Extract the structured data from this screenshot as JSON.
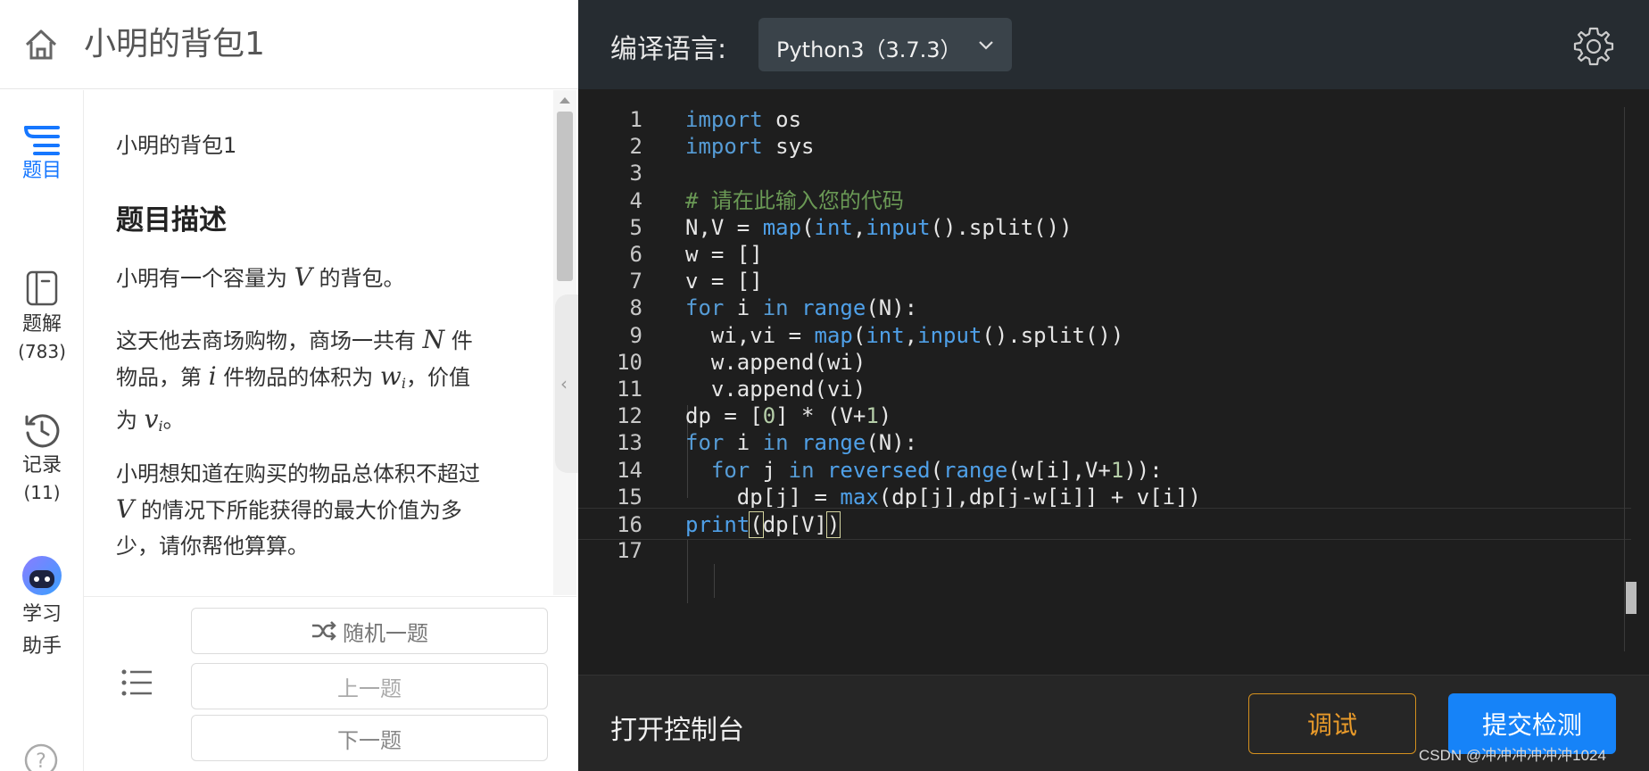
{
  "header": {
    "home_icon": "home-icon",
    "title": "小明的背包1"
  },
  "sidebar": {
    "items": [
      {
        "label": "题目",
        "icon": "list-lines-icon",
        "active": true,
        "color": "#1677ff"
      },
      {
        "label": "题解",
        "count": "(783)",
        "icon": "bookmark-icon"
      },
      {
        "label": "记录",
        "count": "(11)",
        "icon": "history-icon"
      },
      {
        "label": "学习助手",
        "line1": "学习",
        "line2": "助手",
        "icon": "robot-avatar-icon"
      }
    ],
    "help_icon": "question-icon"
  },
  "problem": {
    "name": "小明的背包1",
    "section_title": "题目描述",
    "paragraphs": {
      "p1_a": "小明有一个容量为",
      "p1_var": "V",
      "p1_b": "的背包。",
      "p2_a": "这天他去商场购物，商场一共有",
      "p2_var1": "N",
      "p2_b": "件",
      "p2_c": "物品，第",
      "p2_var2": "i",
      "p2_d": "件物品的体积为",
      "p2_var3": "w",
      "p2_sub3": "i",
      "p2_e": "，价值",
      "p2_f": "为",
      "p2_var4": "v",
      "p2_sub4": "i",
      "p2_g": "。",
      "p3_a": "小明想知道在购买的物品总体积不超过",
      "p3_var": "V",
      "p3_b": "的情况下所能获得的最大价值为多",
      "p3_c": "少，请你帮他算算。"
    }
  },
  "problem_nav": {
    "list_icon": "list-icon",
    "random": "随机一题",
    "random_icon": "shuffle-icon",
    "prev": "上一题",
    "next": "下一题"
  },
  "editor_header": {
    "lang_label": "编译语言:",
    "lang_value": "Python3（3.7.3）",
    "chevron_icon": "chevron-down-icon",
    "settings_icon": "gear-icon"
  },
  "code_lines": [
    "import os",
    "import sys",
    "",
    "# 请在此输入您的代码",
    "N,V = map(int,input().split())",
    "w = []",
    "v = []",
    "for i in range(N):",
    "  wi,vi = map(int,input().split())",
    "  w.append(wi)",
    "  v.append(vi)",
    "dp = [0] * (V+1)",
    "for i in range(N):",
    "  for j in reversed(range(w[i],V+1)):",
    "    dp[j] = max(dp[j],dp[j-w[i]] + v[i])",
    "print(dp[V])",
    ""
  ],
  "footer": {
    "console": "打开控制台",
    "debug": "调试",
    "submit": "提交检测",
    "debug_color": "#e89a2a",
    "submit_color": "#1683f8"
  },
  "watermark": "CSDN @冲冲冲冲冲冲1024"
}
